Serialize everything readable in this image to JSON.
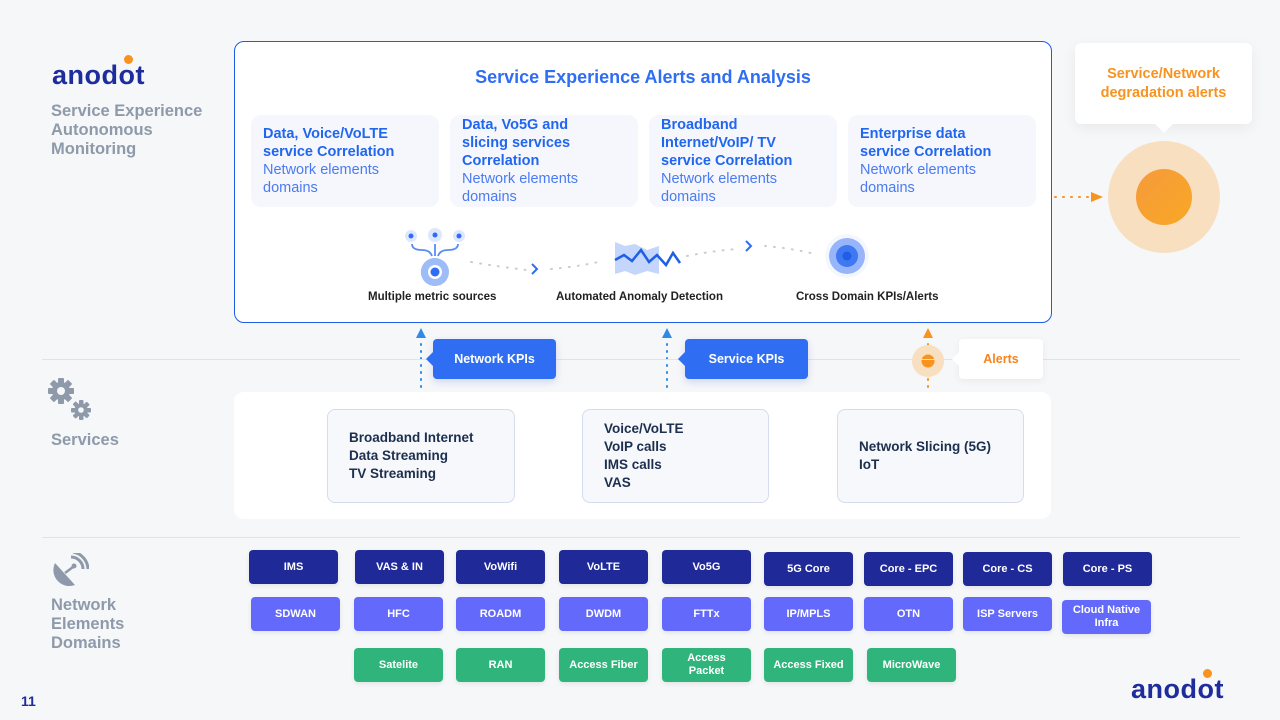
{
  "brand": {
    "logo_text": "anod",
    "logo_suffix": "t",
    "accent_dot": "#f7931e",
    "primary": "#1f2d9c"
  },
  "left_labels": {
    "monitoring": [
      "Service Experience",
      "Autonomous",
      "Monitoring"
    ],
    "services": "Services",
    "network": [
      "Network",
      "Elements",
      "Domains"
    ]
  },
  "main_panel": {
    "title": "Service Experience Alerts and Analysis",
    "correlation_cards": [
      {
        "title": [
          "Data, Voice/VoLTE",
          "service Correlation"
        ],
        "subtitle": [
          "Network elements",
          "domains"
        ]
      },
      {
        "title": [
          "Data, Vo5G and",
          "slicing services",
          "Correlation"
        ],
        "subtitle": [
          "Network elements",
          "domains"
        ]
      },
      {
        "title": [
          "Broadband",
          "Internet/VoIP/ TV",
          "service Correlation"
        ],
        "subtitle": [
          "Network elements",
          "domains"
        ]
      },
      {
        "title": [
          "Enterprise data",
          "service Correlation"
        ],
        "subtitle": [
          "Network elements",
          "domains"
        ]
      }
    ],
    "flow_steps": [
      {
        "label": "Multiple metric sources",
        "icon": "metric-sources-icon"
      },
      {
        "label": "Automated Anomaly Detection",
        "icon": "anomaly-detection-icon"
      },
      {
        "label": "Cross Domain KPIs/Alerts",
        "icon": "target-icon"
      }
    ]
  },
  "degradation_alert": {
    "lines": [
      "Service/Network",
      "degradation alerts"
    ]
  },
  "tags": {
    "network_kpis": "Network KPIs",
    "service_kpis": "Service KPIs",
    "alerts": "Alerts"
  },
  "services": [
    [
      "Broadband Internet",
      "Data Streaming",
      "TV Streaming"
    ],
    [
      "Voice/VoLTE",
      "VoIP calls",
      "IMS calls",
      "VAS"
    ],
    [
      "Network Slicing (5G)",
      "IoT"
    ]
  ],
  "domains": {
    "core": [
      "IMS",
      "VAS & IN",
      "VoWifi",
      "VoLTE",
      "Vo5G",
      "5G Core",
      "Core - EPC",
      "Core - CS",
      "Core - PS"
    ],
    "transport": [
      "SDWAN",
      "HFC",
      "ROADM",
      "DWDM",
      "FTTx",
      "IP/MPLS",
      "OTN",
      "ISP Servers",
      "Cloud Native Infra"
    ],
    "access": [
      "Satelite",
      "RAN",
      "Access Fiber",
      "Access Packet",
      "Access Fixed",
      "MicroWave"
    ]
  },
  "colors": {
    "core": "#1f2a98",
    "transport": "#6369fb",
    "access": "#2fb57b",
    "kpi": "#2f6df2",
    "alert": "#f7931e"
  },
  "page_number": "11"
}
